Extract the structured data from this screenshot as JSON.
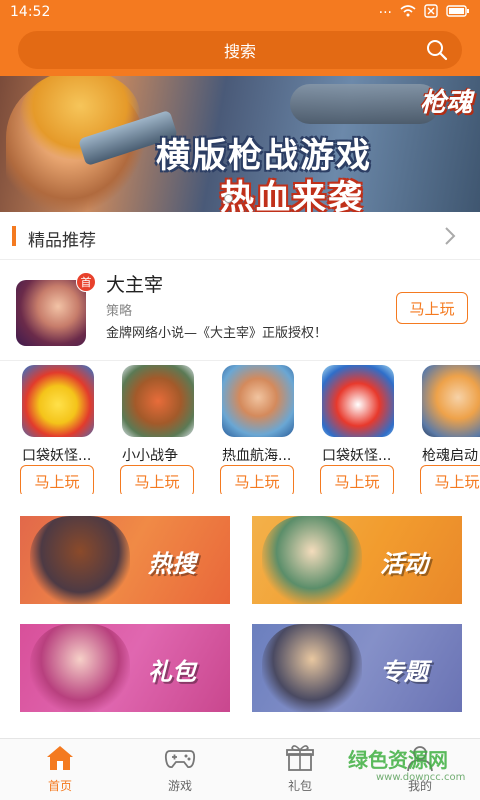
{
  "status_bar": {
    "time": "14:52",
    "signal_icon": "signal-dots-icon",
    "wifi_icon": "wifi-icon",
    "sim_icon": "sim-x-icon",
    "battery_icon": "battery-icon"
  },
  "search": {
    "placeholder": "搜索",
    "icon": "search-icon"
  },
  "banner": {
    "logo": "枪魂",
    "headline_1": "横版枪战游戏",
    "headline_2": "热血来袭",
    "page_indicator": "1"
  },
  "section": {
    "title": "精品推荐",
    "more_icon": "chevron-right-icon"
  },
  "featured": {
    "name": "大主宰",
    "badge": "首",
    "category": "策略",
    "description": "金牌网络小说—《大主宰》正版授权！",
    "play_label": "马上玩"
  },
  "games": [
    {
      "name": "口袋妖怪...",
      "play_label": "马上玩"
    },
    {
      "name": "小小战争",
      "play_label": "马上玩"
    },
    {
      "name": "热血航海...",
      "play_label": "马上玩"
    },
    {
      "name": "口袋妖怪...",
      "play_label": "马上玩"
    },
    {
      "name": "枪魂启动",
      "play_label": "马上玩"
    }
  ],
  "tiles": [
    {
      "label": "热搜"
    },
    {
      "label": "活动"
    },
    {
      "label": "礼包"
    },
    {
      "label": "专题"
    }
  ],
  "nav": [
    {
      "label": "首页",
      "icon": "home-icon",
      "active": true
    },
    {
      "label": "游戏",
      "icon": "gamepad-icon"
    },
    {
      "label": "礼包",
      "icon": "gift-icon"
    },
    {
      "label": "我的",
      "icon": "person-icon"
    }
  ],
  "watermark": {
    "text": "绿色资源网",
    "sub": "www.downcc.com"
  },
  "colors": {
    "brand": "#f47a20",
    "search_bg": "#e36a14",
    "badge": "#e8412c"
  }
}
